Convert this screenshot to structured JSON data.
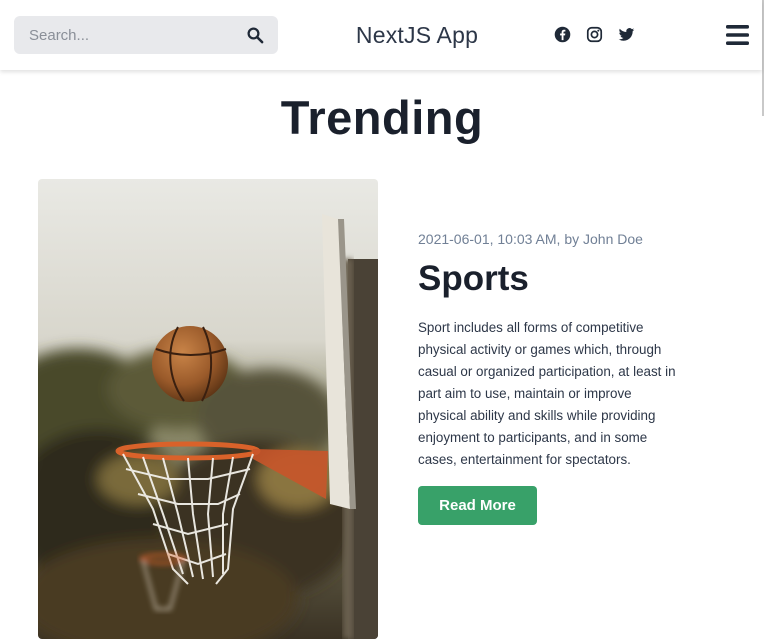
{
  "header": {
    "search": {
      "placeholder": "Search...",
      "value": ""
    },
    "brand": "NextJS App",
    "social_icons": [
      "facebook-icon",
      "instagram-icon",
      "twitter-icon"
    ],
    "menu_icon": "hamburger-menu-icon"
  },
  "main": {
    "title": "Trending",
    "post": {
      "meta": "2021-06-01, 10:03 AM, by John Doe",
      "title": "Sports",
      "excerpt": "Sport includes all forms of competitive physical activity or games which, through casual or organized participation, at least in part aim to use, maintain or improve physical ability and skills while providing enjoyment to participants, and in some cases, entertainment for spectators.",
      "button_label": "Read More",
      "image": "basketball-hoop-photo"
    }
  },
  "colors": {
    "accent": "#38a169",
    "meta_text": "#718096",
    "heading": "#1a202c",
    "search_bg": "#e8e9ec"
  }
}
